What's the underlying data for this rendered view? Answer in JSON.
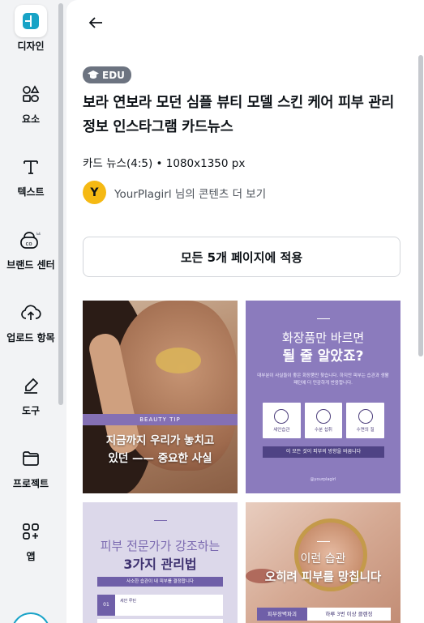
{
  "rail": {
    "items": [
      {
        "label": "디자인",
        "icon": "canva-logo-icon"
      },
      {
        "label": "요소",
        "icon": "elements-icon"
      },
      {
        "label": "텍스트",
        "icon": "text-t-icon"
      },
      {
        "label": "브랜드 센터",
        "icon": "brand-icon"
      },
      {
        "label": "업로드 항목",
        "icon": "cloud-upload-icon"
      },
      {
        "label": "도구",
        "icon": "draw-tool-icon"
      },
      {
        "label": "프로젝트",
        "icon": "folder-icon"
      },
      {
        "label": "앱",
        "icon": "apps-icon"
      }
    ]
  },
  "panel": {
    "badge": "EDU",
    "title": "보라 연보라 모던 심플 뷰티 모델 스킨 케어 피부 관리 정보 인스타그램 카드뉴스",
    "meta": "카드 뉴스(4:5) • 1080x1350 px",
    "creator_initial": "Y",
    "creator_text": "YourPlagirl 님의 콘텐츠 더 보기",
    "apply_button": "모든 5개 페이지에 적용"
  },
  "thumbs": {
    "t1": {
      "band": "BEAUTY TIP",
      "line1": "지금까지 우리가 놓치고",
      "line2": "있던 —— 중요한 사실"
    },
    "t2": {
      "h1": "화장품만 바르면",
      "h2": "될 줄 알았죠?",
      "small": "대부분이 사실들이 좋은 화장품만 찾습니다. 하지만 피부는 습관과 생활 패턴에 더 민감하게 반응합니다.",
      "cards": [
        "세안습관",
        "수분 섭취",
        "수면의 질"
      ],
      "bar": "이 모든 것이 피부의 방향을 바꿉니다",
      "handle": "@yourplagirl"
    },
    "t3": {
      "h1": "피부 전문가가 강조하는",
      "h2": "3가지 관리법",
      "bar": "사소한 습관이 내 피부를 결정합니다",
      "num": "01",
      "row_title": "세안 루틴"
    },
    "t4": {
      "h1": "이런 습관",
      "h2": "오히려 피부를 망칩니다",
      "band_left": "피부장벽파괴",
      "band_right": "하루 3번 이상 클렌징"
    }
  },
  "colors": {
    "accent": "#8b7bbd",
    "badge": "#6c7380",
    "avatar": "#f5b913"
  }
}
